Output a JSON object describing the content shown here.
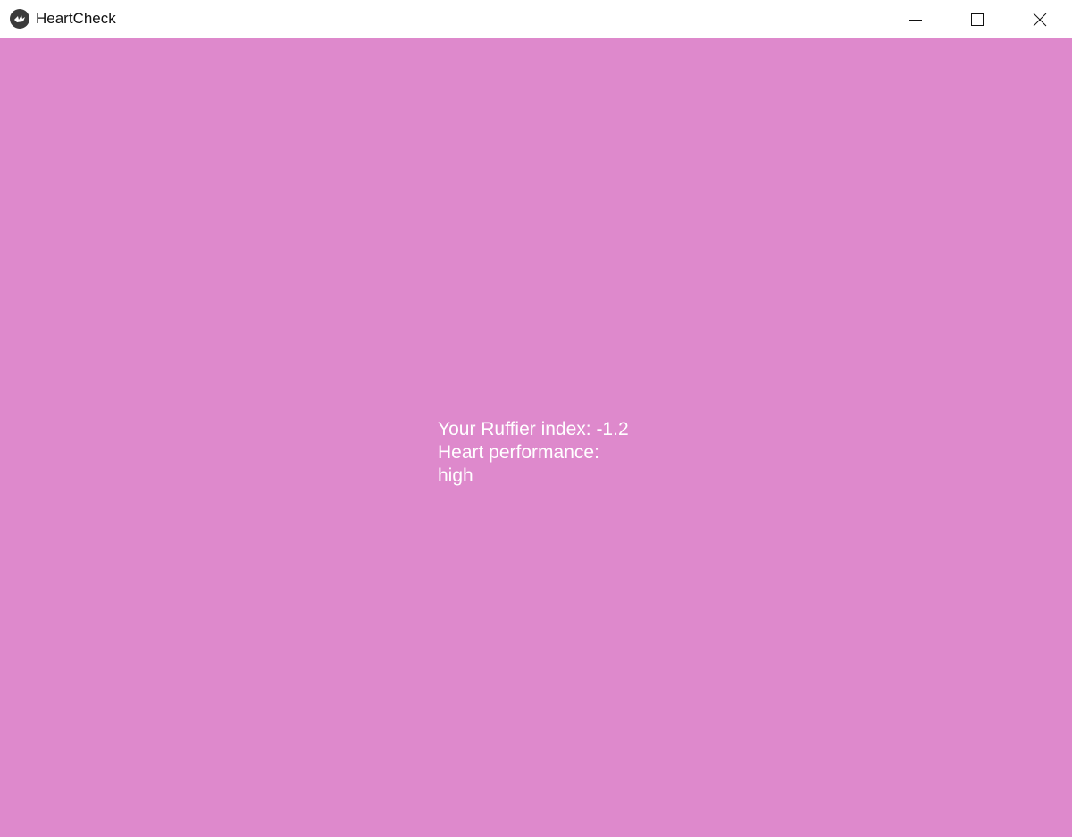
{
  "window": {
    "title": "HeartCheck",
    "background_color": "#de89cc",
    "icon": "kivy-logo-icon"
  },
  "controls": {
    "minimize_icon": "minimize-icon",
    "maximize_icon": "maximize-icon",
    "close_icon": "close-icon"
  },
  "result": {
    "index_line": "Your Ruffier index: -1.2",
    "performance_line": "Heart performance:",
    "performance_value": "high",
    "text_color": "#ffffff"
  }
}
